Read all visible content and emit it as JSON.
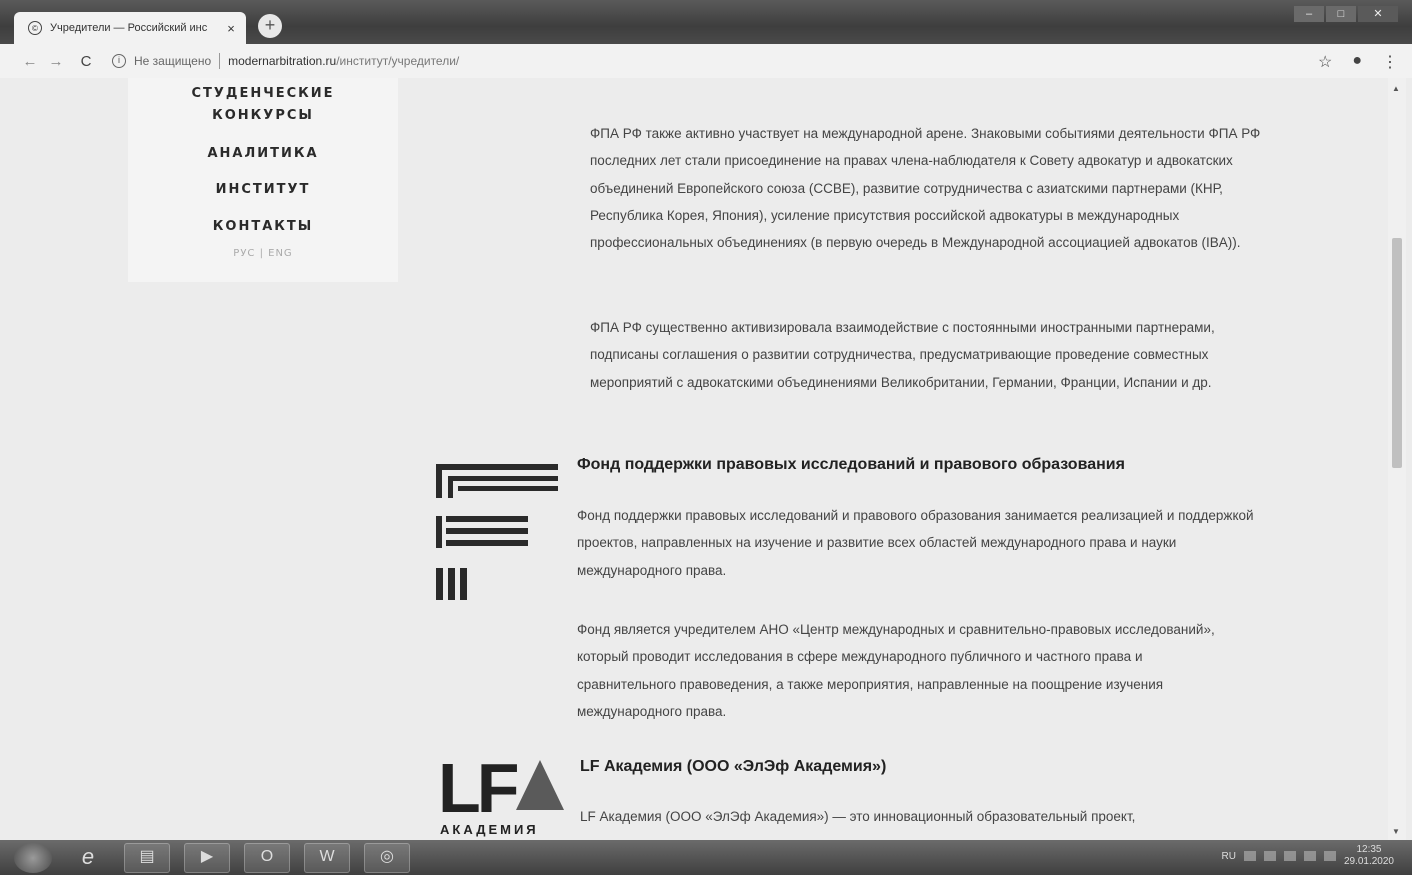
{
  "browser": {
    "tab_title": "Учредители — Российский инс",
    "tab_close": "×",
    "new_tab": "+",
    "not_secure": "Не защищено",
    "url_host": "modernarbitration.ru",
    "url_path": "/институт/учредители/"
  },
  "menu": {
    "items": [
      "СТУДЕНЧЕСКИЕ",
      "КОНКУРСЫ",
      "АНАЛИТИКА",
      "ИНСТИТУТ",
      "КОНТАКТЫ"
    ],
    "lang_switch": "РУС | ENG"
  },
  "content": {
    "paragraphs": [
      "ФПА РФ также активно участвует на международной арене. Знаковыми событиями деятельности ФПА РФ последних лет стали присоединение на правах члена-наблюдателя к Совету адвокатур и адвокатских объединений Европейского союза (CCBE), развитие сотрудничества с азиатскими партнерами (КНР, Республика Корея, Япония), усиление присутствия российской адвокатуры в международных профессиональных объединениях (в первую очередь в Международной ассоциацией адвокатов (IBA)).",
      "ФПА РФ существенно активизировала взаимодействие с постоянными иностранными партнерами, подписаны соглашения о развитии сотрудничества, предусматривающие проведение совместных мероприятий с адвокатскими объединениями Великобритании, Германии, Франции, Испании и др."
    ],
    "fond": {
      "title": "Фонд поддержки правовых исследований и правового образования",
      "paragraphs": [
        "Фонд поддержки правовых исследований и правового образования занимается реализацией и поддержкой проектов, направленных на изучение и развитие всех областей международного права и науки международного права.",
        "Фонд является учредителем АНО «Центр международных и сравнительно-правовых исследований», который проводит исследования в сфере международного публичного и частного права и сравнительного правоведения, а также мероприятия, направленные на поощрение изучения международного права."
      ]
    },
    "lf": {
      "logo_text": "LF",
      "logo_sub": "АКАДЕМИЯ",
      "title": "LF Академия (ООО «ЭлЭф Академия»)",
      "paragraph": "LF Академия (ООО «ЭлЭф Академия») — это инновационный образовательный проект,"
    }
  },
  "taskbar": {
    "lang": "RU",
    "time": "12:35",
    "date": "29.01.2020"
  },
  "colors": {
    "page_bg": "#ececec",
    "menu_bg": "#f4f4f4",
    "text": "#444444"
  }
}
